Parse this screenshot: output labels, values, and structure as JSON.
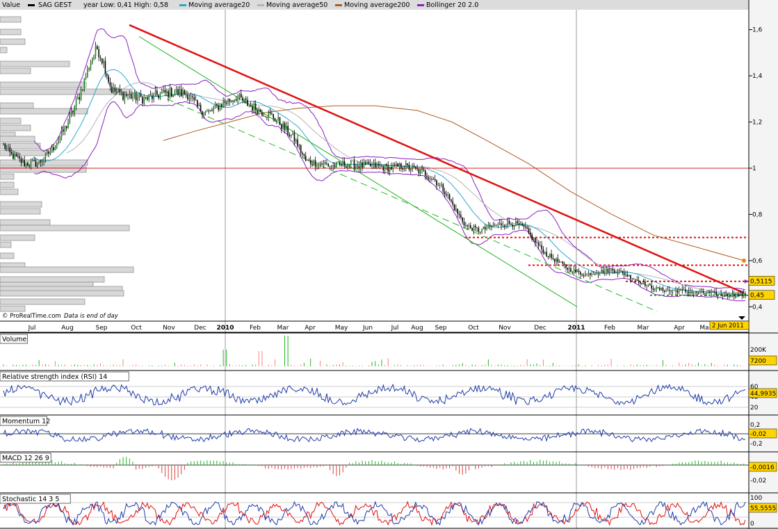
{
  "legend": {
    "value_label": "Value",
    "series_label": "SAG GEST",
    "year_range": "year Low: 0,41 High: 0,58",
    "ma20": "Moving average20",
    "ma50": "Moving average50",
    "ma200": "Moving average200",
    "boll": "Bollinger 20 2.0"
  },
  "credit": {
    "source": "© ProRealTime.com",
    "note": "Data is end of day"
  },
  "date_badge": "2 Jun 2011",
  "colors": {
    "candle_up": "#ffffff",
    "candle_down": "#000000",
    "ma20": "#2aa8c8",
    "ma50": "#b4b4b4",
    "ma200": "#b05a20",
    "bollinger": "#8a1fc0",
    "trend_red": "#e01010",
    "channel_green": "#22b722",
    "support_red_dotted": "#e01010",
    "support_green_dotted": "#22a022",
    "horizontal_red": "#d02020",
    "panel_line": "#1f3aa8",
    "volume_bar": "#ff8080",
    "volume_bar_green": "#22b722",
    "macd_pos": "#22b722",
    "macd_neg": "#e04040",
    "stoch_k": "#1f3aa8",
    "stoch_d": "#e01010",
    "sidebar_bg": "#f0f0f0"
  },
  "chart_data": [
    {
      "type": "candlestick",
      "name": "main",
      "x_labels": [
        "Jul",
        "Aug",
        "Sep",
        "Oct",
        "Nov",
        "Dec",
        "2010",
        "Feb",
        "Mar",
        "Apr",
        "May",
        "Jun",
        "Jul",
        "Aug",
        "Sep",
        "Oct",
        "Nov",
        "Dec",
        "2011",
        "Feb",
        "Mar",
        "Apr",
        "Ma"
      ],
      "y_ticks": [
        "1,6",
        "1,4",
        "1,2",
        "1",
        "0,8",
        "0,6",
        "0,4"
      ],
      "ylim": [
        0.38,
        1.68
      ],
      "close_anchors": [
        [
          0,
          1.12
        ],
        [
          15,
          1.06
        ],
        [
          35,
          1.02
        ],
        [
          55,
          1.02
        ],
        [
          75,
          1.08
        ],
        [
          95,
          1.18
        ],
        [
          115,
          1.32
        ],
        [
          130,
          1.46
        ],
        [
          140,
          1.52
        ],
        [
          150,
          1.45
        ],
        [
          160,
          1.34
        ],
        [
          175,
          1.32
        ],
        [
          190,
          1.31
        ],
        [
          210,
          1.3
        ],
        [
          230,
          1.32
        ],
        [
          250,
          1.33
        ],
        [
          270,
          1.32
        ],
        [
          285,
          1.26
        ],
        [
          300,
          1.24
        ],
        [
          320,
          1.28
        ],
        [
          340,
          1.31
        ],
        [
          360,
          1.27
        ],
        [
          380,
          1.24
        ],
        [
          395,
          1.22
        ],
        [
          410,
          1.17
        ],
        [
          425,
          1.12
        ],
        [
          440,
          1.03
        ],
        [
          460,
          1.02
        ],
        [
          480,
          1.01
        ],
        [
          500,
          1.02
        ],
        [
          520,
          1.01
        ],
        [
          540,
          1.01
        ],
        [
          560,
          1.0
        ],
        [
          580,
          1.01
        ],
        [
          600,
          0.99
        ],
        [
          610,
          0.98
        ],
        [
          625,
          0.95
        ],
        [
          640,
          0.9
        ],
        [
          655,
          0.82
        ],
        [
          670,
          0.75
        ],
        [
          690,
          0.73
        ],
        [
          710,
          0.75
        ],
        [
          725,
          0.76
        ],
        [
          740,
          0.76
        ],
        [
          755,
          0.74
        ],
        [
          770,
          0.68
        ],
        [
          785,
          0.63
        ],
        [
          800,
          0.6
        ],
        [
          820,
          0.56
        ],
        [
          840,
          0.54
        ],
        [
          860,
          0.55
        ],
        [
          880,
          0.56
        ],
        [
          900,
          0.54
        ],
        [
          920,
          0.51
        ],
        [
          940,
          0.48
        ],
        [
          960,
          0.47
        ],
        [
          980,
          0.47
        ],
        [
          1000,
          0.46
        ],
        [
          1020,
          0.46
        ],
        [
          1040,
          0.45
        ],
        [
          1060,
          0.45
        ],
        [
          1070,
          0.45
        ]
      ],
      "hlines": [
        {
          "value": 1.0,
          "style": "solid",
          "color": "horizontal_red"
        },
        {
          "value": 0.7,
          "style": "dotted",
          "color": "support_red_dotted"
        },
        {
          "value": 0.58,
          "style": "dotted",
          "color": "support_red_dotted"
        },
        {
          "value": 0.51,
          "style": "dotted",
          "color": "support_red_dotted"
        },
        {
          "value": 0.45,
          "style": "dotted",
          "color": "support_green_dotted"
        }
      ],
      "value_labels": [
        {
          "text": "0,5115",
          "value": 0.5115
        },
        {
          "text": "0,45",
          "value": 0.45
        }
      ]
    },
    {
      "type": "bar",
      "name": "Volume",
      "title": "Volume",
      "y_ticks": [
        "200K"
      ],
      "last_label": "7200"
    },
    {
      "type": "line",
      "name": "Relative strength index (RSI) 14",
      "title": "Relative strength index (RSI) 14",
      "y_ticks": [
        "60",
        "40",
        "20"
      ],
      "last_label": "44,9935"
    },
    {
      "type": "line",
      "name": "Momentum 12",
      "title": "Momentum 12",
      "y_ticks": [
        "0,2",
        "0",
        "-0,2"
      ],
      "last_label": "-0,02"
    },
    {
      "type": "bar",
      "name": "MACD 12 26 9",
      "title": "MACD 12 26 9",
      "y_ticks": [
        "-0,02"
      ],
      "last_label": "-0,0016"
    },
    {
      "type": "line",
      "name": "Stochastic 14 3 5",
      "title": "Stochastic 14 3 5",
      "y_ticks": [
        "100",
        "50",
        "0"
      ],
      "last_label": "55,5555"
    }
  ]
}
